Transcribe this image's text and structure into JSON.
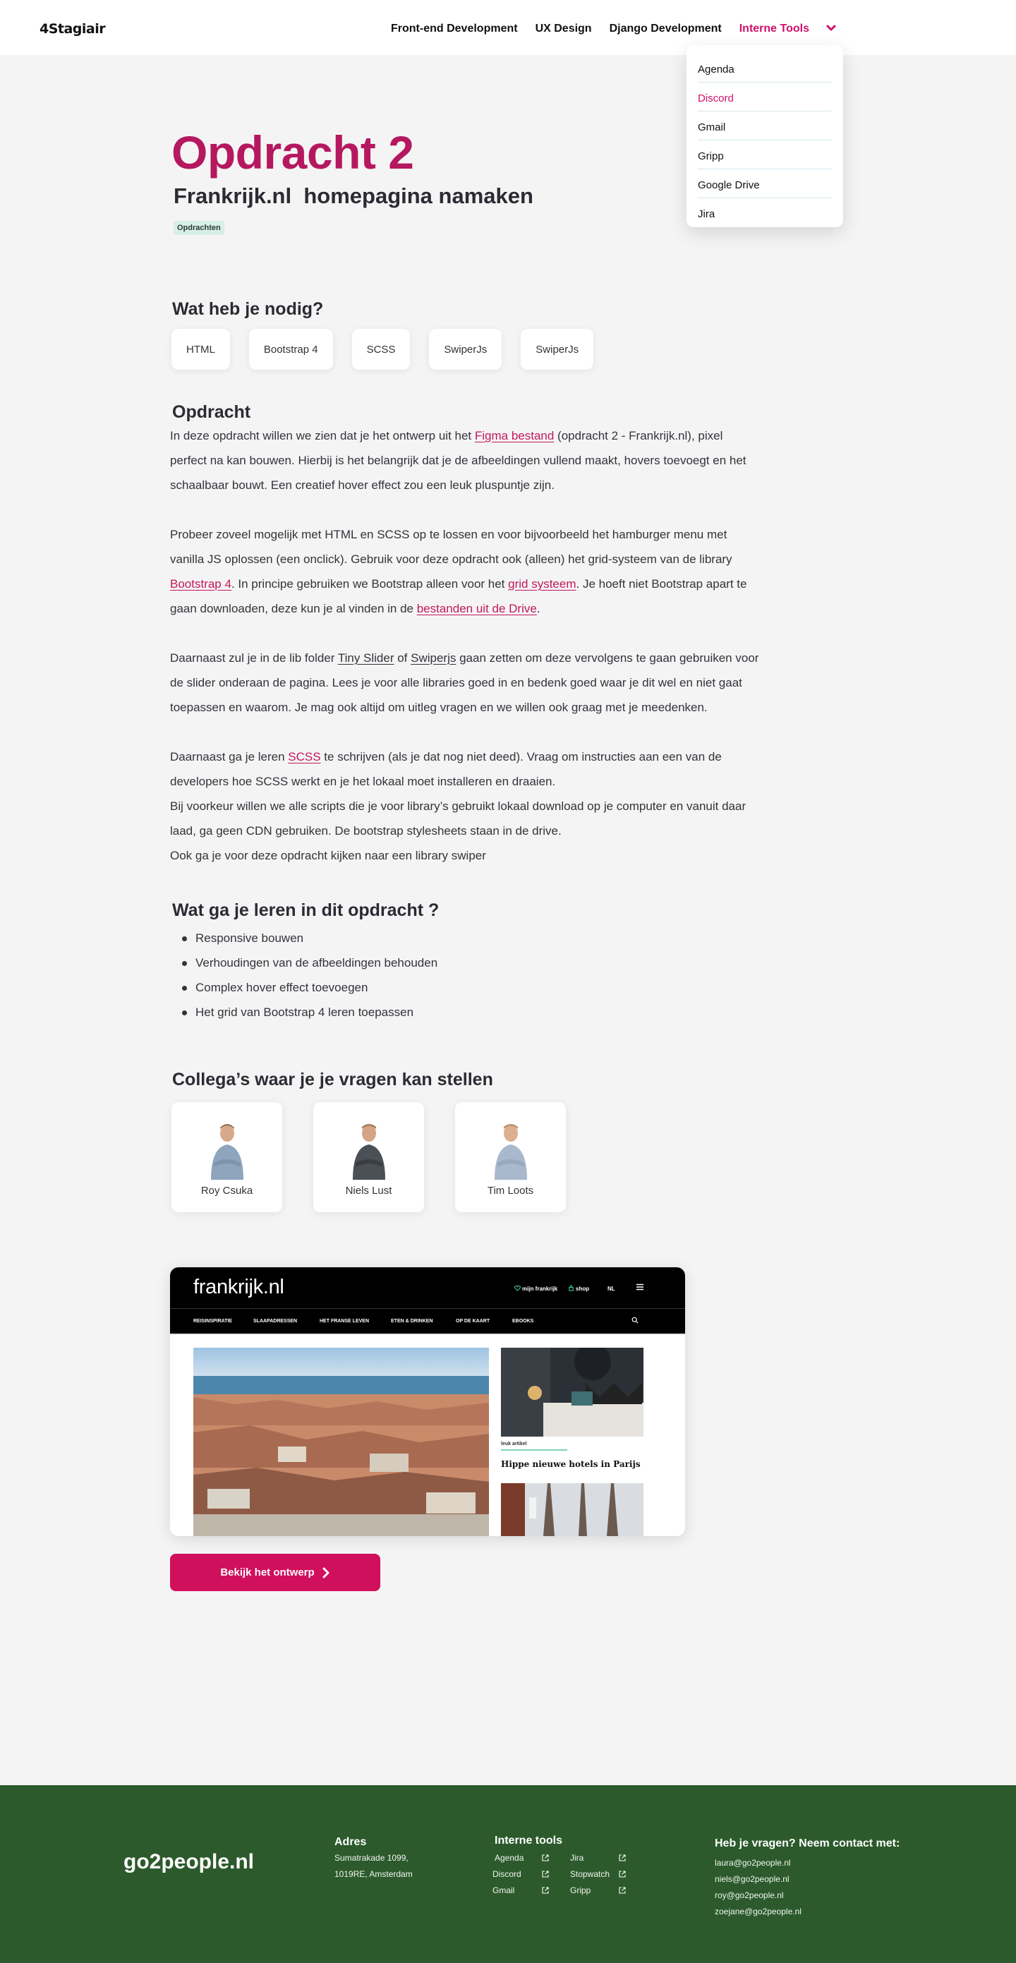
{
  "nav": {
    "brand": "4Stagiair",
    "links": [
      "Front-end Development",
      "UX Design",
      "Django Development",
      "Interne Tools"
    ],
    "dropdown": [
      "Agenda",
      "Discord",
      "Gmail",
      "Gripp",
      "Google Drive",
      "Jira"
    ]
  },
  "header": {
    "title": "Opdracht 2",
    "subtitle": "Frankrijk.nl  homepagina namaken",
    "tag": "Opdrachten"
  },
  "needs": {
    "heading": "Wat heb je nodig?",
    "tools": [
      "HTML",
      "Bootstrap 4",
      "SCSS",
      "SwiperJs",
      "SwiperJs"
    ]
  },
  "assignment": {
    "heading": "Opdracht",
    "p1": {
      "a": "In deze opdracht willen we zien dat je het ontwerp uit het ",
      "link": "Figma bestand",
      "b": " (opdracht 2 - Frankrijk.nl), pixel perfect na kan bouwen. Hierbij is het belangrijk dat je de afbeeldingen vullend maakt, hovers toevoegt en het schaalbaar bouwt. Een creatief hover effect zou een leuk pluspuntje zijn."
    },
    "p2": {
      "a": "Probeer zoveel mogelijk met HTML en SCSS op te lossen en voor bijvoorbeeld het hamburger menu met vanilla JS oplossen (een onclick). Gebruik voor deze opdracht ook (alleen) het grid-systeem van de library ",
      "link1": "Bootstrap 4",
      "b": ". In principe gebruiken we Bootstrap alleen voor het ",
      "link2": "grid systeem",
      "c": ". Je hoeft niet Bootstrap apart te gaan downloaden, deze kun je al vinden in de ",
      "link3": "bestanden uit de Drive",
      "d": "."
    },
    "p3": {
      "a": "Daarnaast zul je in de lib folder ",
      "link1": "Tiny Slider",
      "b": " of ",
      "link2": "Swiperjs",
      "c": " gaan zetten om deze vervolgens te gaan gebruiken voor de slider onderaan de pagina. Lees je voor alle libraries goed in en bedenk goed waar je dit wel en niet gaat toepassen en waarom. Je mag ook altijd om uitleg vragen en we willen ook graag met je meedenken."
    },
    "p4": {
      "a": "Daarnaast ga je leren ",
      "link": "SCSS",
      "b": " te schrijven (als je dat nog niet deed). Vraag om instructies aan een van de developers hoe SCSS werkt en je het lokaal moet installeren en draaien.",
      "line2": "Bij voorkeur willen we alle scripts die je voor library’s gebruikt lokaal download op je computer en vanuit daar laad, ga geen CDN gebruiken. De bootstrap stylesheets staan in de drive.",
      "line3": "Ook ga je voor deze opdracht kijken naar een library swiper"
    }
  },
  "learn": {
    "heading": "Wat ga je leren in dit opdracht ?",
    "items": [
      "Responsive bouwen",
      "Verhoudingen van de afbeeldingen behouden",
      "Complex hover effect toevoegen",
      "Het grid van Bootstrap 4 leren toepassen"
    ]
  },
  "colleagues": {
    "heading": "Collega’s waar je je vragen kan stellen",
    "people": [
      "Roy Csuka",
      "Niels Lust",
      "Tim Loots"
    ]
  },
  "preview": {
    "logo": "frankrijk.nl",
    "util": [
      "mijn frankrijk",
      "shop",
      "NL"
    ],
    "menu": [
      "REISINSPIRATIE",
      "SLAAPADRESSEN",
      "HET FRANSE LEVEN",
      "ETEN & DRINKEN",
      "OP DE KAART",
      "EBOOKS"
    ],
    "kicker": "leuk artikel",
    "headline": "Hippe nieuwe hotels in Parijs"
  },
  "cta": {
    "label": "Bekijk het ontwerp"
  },
  "footer": {
    "brand": "go2people.nl",
    "address_heading": "Adres",
    "address_lines": [
      "Sumatrakade 1099,",
      "1019RE, Amsterdam"
    ],
    "tools_heading": "Interne tools",
    "tools_col1": [
      "Agenda",
      "Discord",
      "Gmail"
    ],
    "tools_col2": [
      "Jira",
      "Stopwatch",
      "Gripp"
    ],
    "contact_heading": "Heb je vragen? Neem contact met:",
    "contacts": [
      "laura@go2people.nl",
      "niels@go2people.nl",
      "roy@go2people.nl",
      "zoejane@go2people.nl"
    ]
  },
  "colors": {
    "accent": "#d00f6b",
    "title": "#b5185f",
    "footer": "#2c5a2c",
    "tag": "#d7efe6"
  }
}
